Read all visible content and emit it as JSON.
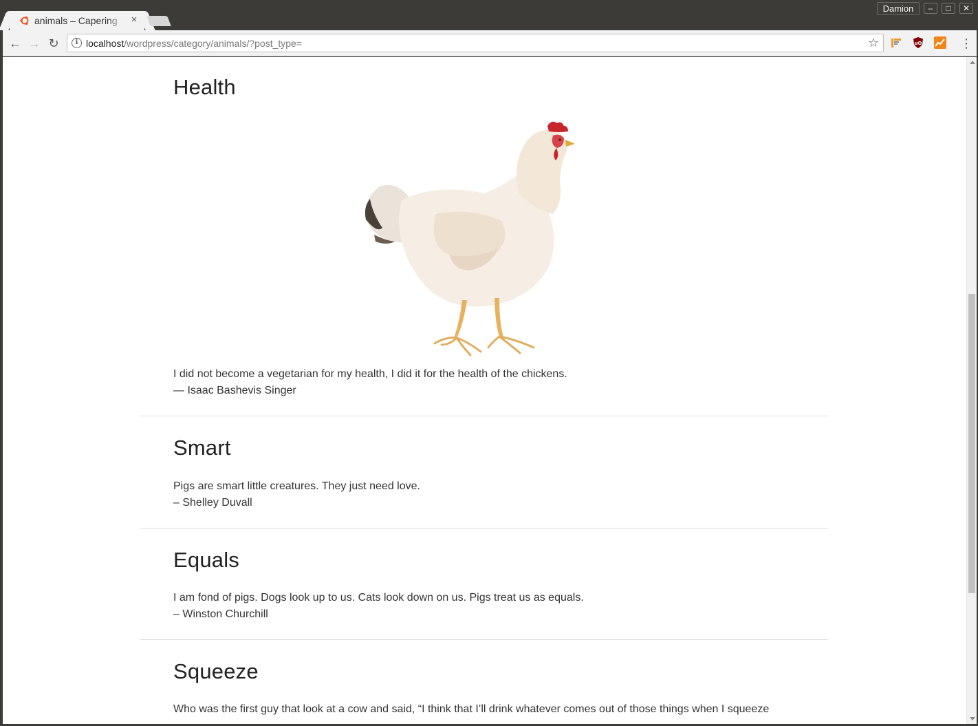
{
  "browser": {
    "tab_title": "animals – Capering",
    "tab_close": "×",
    "profile_name": "Damion",
    "url_host": "localhost",
    "url_path": "/wordpress/category/animals/?post_type=",
    "window_controls": {
      "minimize": "–",
      "maximize": "□",
      "close": "✕"
    },
    "nav": {
      "back": "←",
      "forward": "→",
      "reload": "↻"
    },
    "icons": [
      "ubuntu-favicon-icon",
      "info-icon",
      "star-icon",
      "bookmarks-extension-icon",
      "ublock-origin-icon",
      "analytics-extension-icon",
      "menu-icon"
    ]
  },
  "posts": [
    {
      "title": "Health",
      "image": "chicken",
      "quote_line1": "I did not become a vegetarian for my health, I did it for the health of the chickens.",
      "quote_line2": "— Isaac Bashevis Singer"
    },
    {
      "title": "Smart",
      "quote_line1": "Pigs are smart little creatures. They just need love.",
      "quote_line2": "– Shelley Duvall"
    },
    {
      "title": "Equals",
      "quote_line1": "I am fond of pigs. Dogs look up to us. Cats look down on us. Pigs treat us as equals.",
      "quote_line2": "– Winston Churchill"
    },
    {
      "title": "Squeeze",
      "quote_line1": "Who was the first guy that look at a cow and said, “I think that I’ll drink whatever comes out of those things when I squeeze"
    }
  ],
  "colors": {
    "chrome_frame": "#3c3b37",
    "toolbar": "#f2f2f2",
    "page_bg": "#ffffff",
    "text": "#333333",
    "divider": "#dddddd"
  }
}
